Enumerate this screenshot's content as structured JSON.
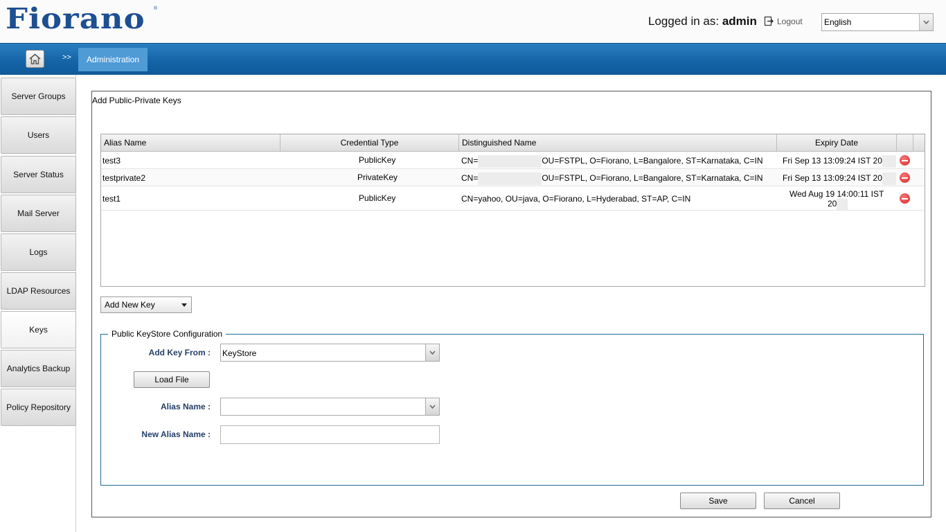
{
  "header": {
    "logo_text": "Fiorano",
    "logged_in_prefix": "Logged in as:",
    "username": "admin",
    "logout_label": "Logout",
    "language": "English"
  },
  "nav": {
    "separator": ">>",
    "breadcrumb": "Administration"
  },
  "sidebar": {
    "items": [
      {
        "label": "Server Groups"
      },
      {
        "label": "Users"
      },
      {
        "label": "Server Status"
      },
      {
        "label": "Mail Server"
      },
      {
        "label": "Logs"
      },
      {
        "label": "LDAP Resources"
      },
      {
        "label": "Keys"
      },
      {
        "label": "Analytics Backup"
      },
      {
        "label": "Policy Repository"
      }
    ],
    "active": "Keys"
  },
  "panel": {
    "title": "Add Public-Private Keys",
    "table": {
      "columns": [
        "Alias Name",
        "Credential Type",
        "Distinguished Name",
        "Expiry Date"
      ],
      "rows": [
        {
          "alias": "test3",
          "type": "PublicKey",
          "dn_prefix": "CN=",
          "dn_suffix": "OU=FSTPL, O=Fiorano, L=Bangalore, ST=Karnataka, C=IN",
          "expiry": "Fri Sep 13 13:09:24 IST 20"
        },
        {
          "alias": "testprivate2",
          "type": "PrivateKey",
          "dn_prefix": "CN=",
          "dn_suffix": "OU=FSTPL, O=Fiorano, L=Bangalore, ST=Karnataka, C=IN",
          "expiry": "Fri Sep 13 13:09:24 IST 20"
        },
        {
          "alias": "test1",
          "type": "PublicKey",
          "dn_prefix": "CN=yahoo, OU=java, O=Fiorano, L=Hyderabad, ST=AP, C=IN",
          "dn_suffix": "",
          "expiry_line1": "Wed Aug 19 14:00:11 IST",
          "expiry_line2": "20"
        }
      ]
    },
    "add_new_key_label": "Add New Key",
    "keystore_config": {
      "legend": "Public KeyStore Configuration",
      "add_key_from_label": "Add Key From :",
      "add_key_from_value": "KeyStore",
      "load_file_label": "Load File",
      "alias_name_label": "Alias Name :",
      "alias_name_value": "",
      "new_alias_name_label": "New Alias Name :",
      "new_alias_name_value": ""
    },
    "save_label": "Save",
    "cancel_label": "Cancel"
  }
}
